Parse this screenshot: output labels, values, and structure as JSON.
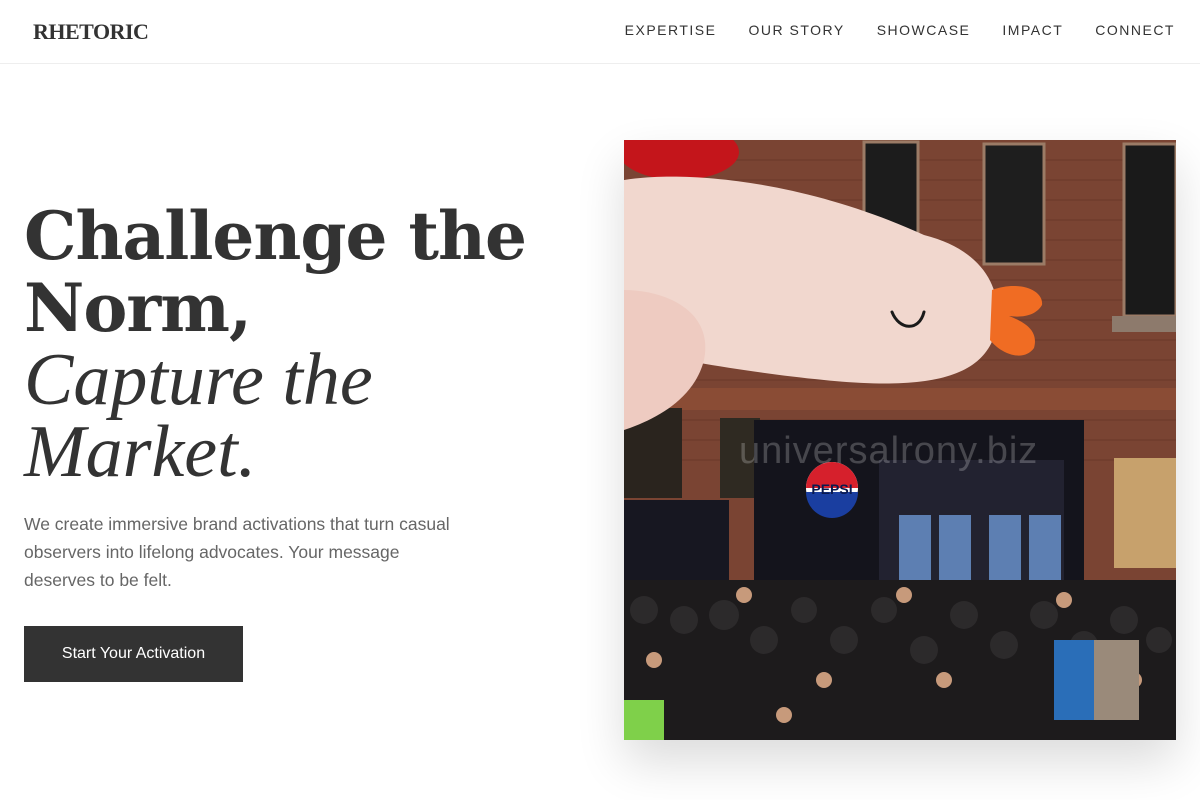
{
  "brand": {
    "logo": "RHETORIC"
  },
  "nav": {
    "items": [
      {
        "label": "EXPERTISE"
      },
      {
        "label": "OUR STORY"
      },
      {
        "label": "SHOWCASE"
      },
      {
        "label": "IMPACT"
      },
      {
        "label": "CONNECT"
      }
    ]
  },
  "hero": {
    "headline_line1": "Challenge the",
    "headline_line2": "Norm,",
    "headline_line3": "Capture the",
    "headline_line4": "Market.",
    "subtext": "We create immersive brand activations that turn casual observers into lifelong advocates. Your message deserves to be felt.",
    "cta_label": "Start Your Activation",
    "image": {
      "watermark": "universalrony.biz",
      "sign_text": "PEPSI"
    }
  },
  "colors": {
    "text_dark": "#333333",
    "text_muted": "#666666",
    "button_bg": "#333333",
    "button_text": "#ffffff"
  }
}
